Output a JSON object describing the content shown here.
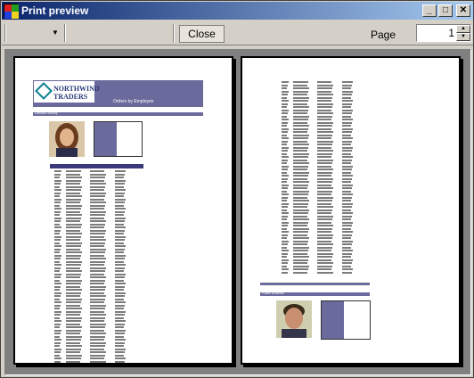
{
  "window": {
    "title": "Print preview",
    "buttons": {
      "minimize": "_",
      "maximize": "□",
      "close": "✕"
    },
    "icon": "print-preview-icon"
  },
  "toolbar": {
    "zoom_dropdown_icon": "chevron-down-icon",
    "close_label": "Close",
    "page_label": "Page",
    "page_value": "1"
  },
  "colors": {
    "title_gradient_start": "#0a246a",
    "title_gradient_end": "#a6caf0",
    "report_band": "#6b6a9c",
    "canvas": "#808080",
    "chrome": "#d4d0c8"
  },
  "preview": {
    "page1": {
      "logo_text": "NORTHWIND TRADERS",
      "header_title": "Orders by Employee",
      "section_label": "Davolio Nancy"
    },
    "page2": {
      "section_label": "Fuller Andrew"
    }
  }
}
